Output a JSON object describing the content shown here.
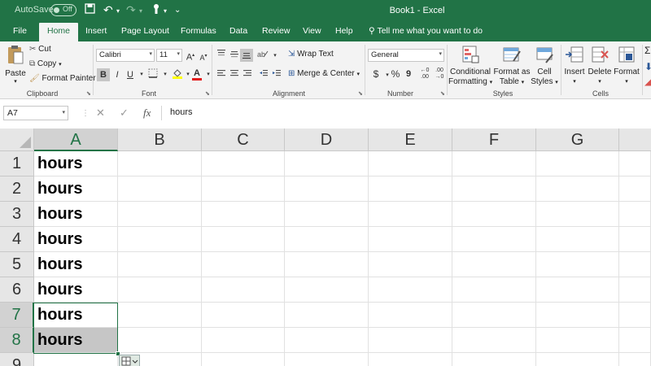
{
  "titlebar": {
    "autosave_label": "AutoSave",
    "autosave_state": "Off",
    "document_title": "Book1  -  Excel",
    "accent_color": "#217346"
  },
  "tabs": [
    "File",
    "Home",
    "Insert",
    "Page Layout",
    "Formulas",
    "Data",
    "Review",
    "View",
    "Help"
  ],
  "active_tab": "Home",
  "tell_me": "Tell me what you want to do",
  "ribbon": {
    "clipboard": {
      "paste": "Paste",
      "cut": "Cut",
      "copy": "Copy",
      "format_painter": "Format Painter",
      "label": "Clipboard"
    },
    "font": {
      "name": "Calibri",
      "size": "11",
      "bold": "B",
      "italic": "I",
      "underline": "U",
      "label": "Font"
    },
    "alignment": {
      "wrap_text": "Wrap Text",
      "merge_center": "Merge & Center",
      "label": "Alignment"
    },
    "number": {
      "format": "General",
      "currency": "$",
      "percent": "%",
      "comma": "9",
      "label": "Number"
    },
    "styles": {
      "conditional_1": "Conditional",
      "conditional_2": "Formatting",
      "format_table_1": "Format as",
      "format_table_2": "Table",
      "cell_styles_1": "Cell",
      "cell_styles_2": "Styles",
      "label": "Styles"
    },
    "cells": {
      "insert": "Insert",
      "delete": "Delete",
      "format": "Format",
      "label": "Cells"
    }
  },
  "formula_bar": {
    "name_box": "A7",
    "cancel": "✕",
    "enter": "✓",
    "fx": "fx",
    "content": "hours"
  },
  "grid": {
    "columns": [
      "A",
      "B",
      "C",
      "D",
      "E",
      "F",
      "G"
    ],
    "selected_column": "A",
    "rows": [
      "1",
      "2",
      "3",
      "4",
      "5",
      "6",
      "7",
      "8",
      "9"
    ],
    "cells_a": [
      "hours",
      "hours",
      "hours",
      "hours",
      "hours",
      "hours",
      "hours",
      "hours",
      ""
    ]
  }
}
